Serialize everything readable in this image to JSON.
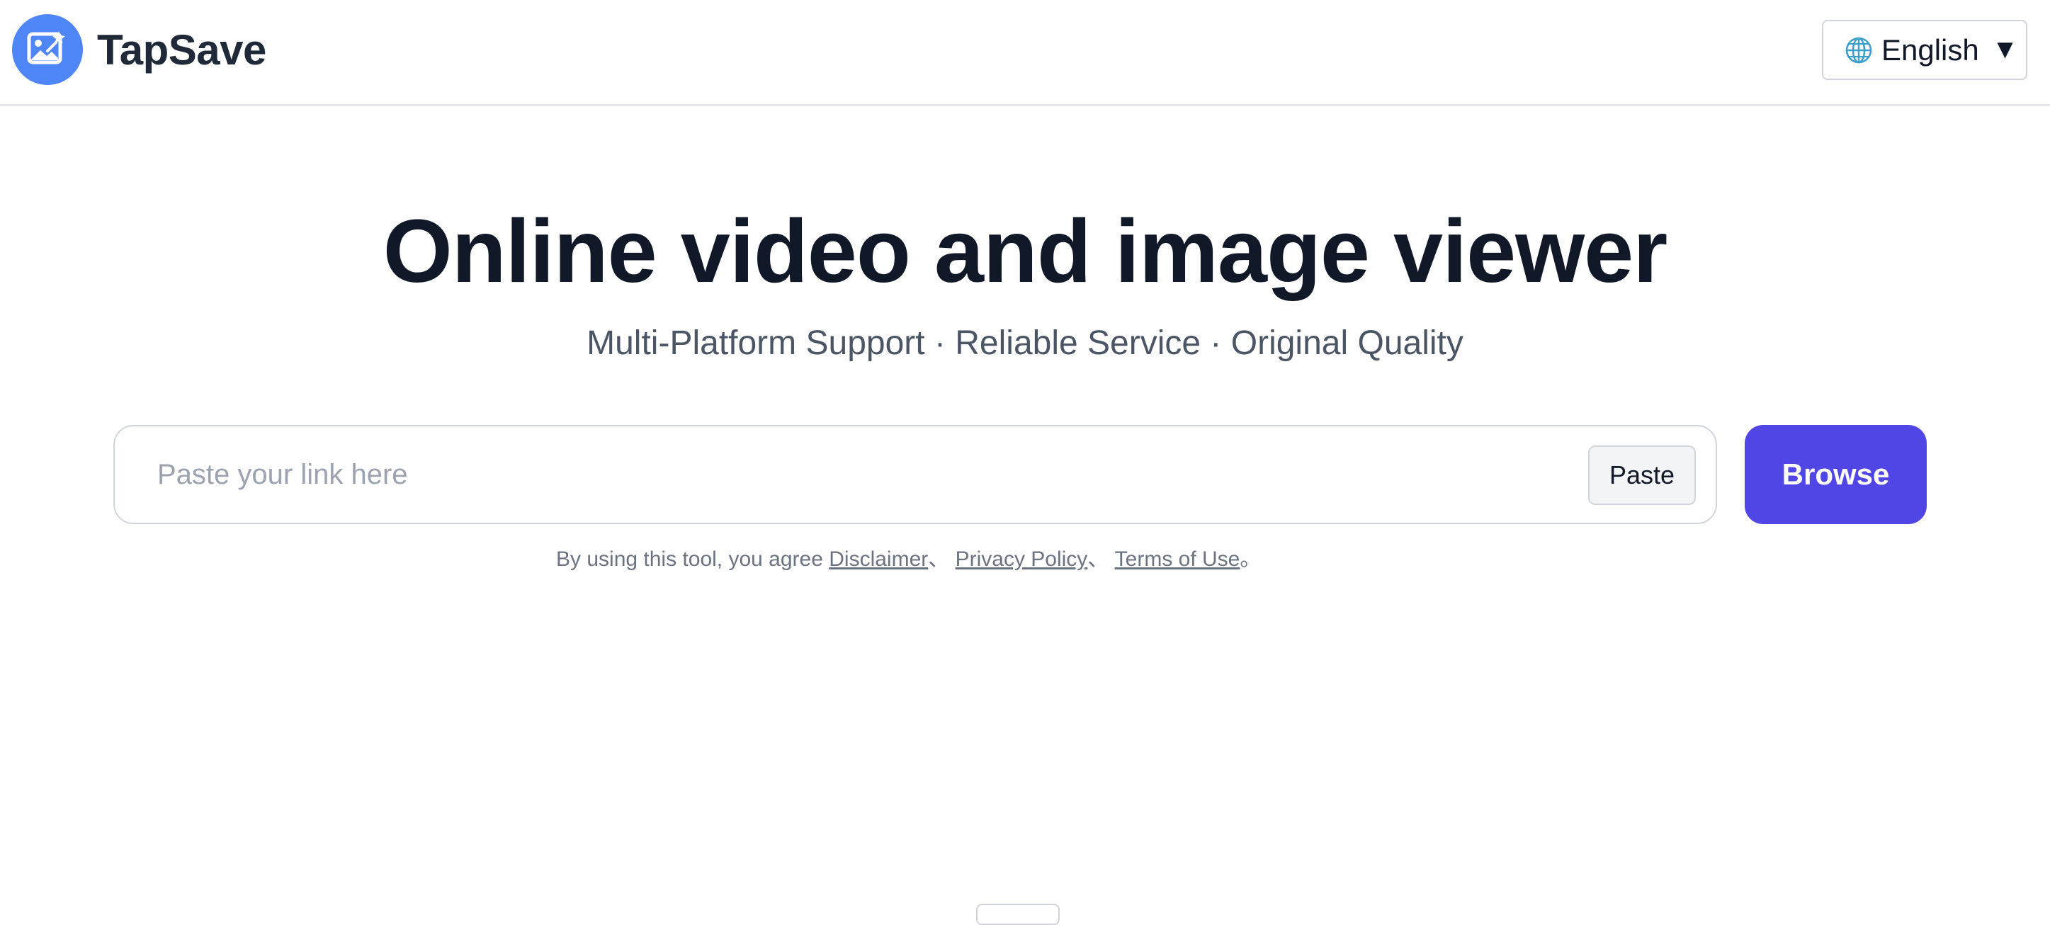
{
  "header": {
    "brand_name": "TapSave",
    "logo_icon": "image-magic-icon",
    "language": {
      "label": "English",
      "caret": "▼",
      "icon": "globe-icon"
    }
  },
  "hero": {
    "title": "Online video and image viewer",
    "subtitle": "Multi-Platform Support · Reliable Service · Original Quality"
  },
  "search": {
    "placeholder": "Paste your link here",
    "value": "",
    "paste_label": "Paste",
    "browse_label": "Browse"
  },
  "agreement": {
    "prefix": "By using this tool, you agree ",
    "disclaimer": "Disclaimer",
    "sep1": "、 ",
    "privacy": "Privacy Policy",
    "sep2": "、 ",
    "terms": "Terms of Use",
    "end": "。"
  },
  "colors": {
    "accent": "#4f46e5",
    "logo_bg": "#4f86f7",
    "title": "#111827",
    "subtitle": "#4b5563"
  }
}
